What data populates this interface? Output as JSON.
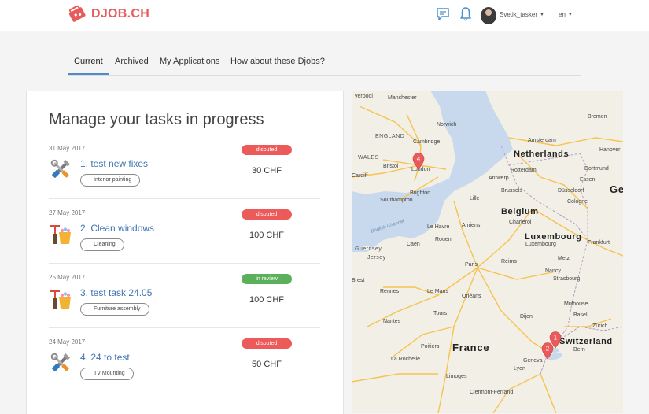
{
  "header": {
    "brand": "DJOB.CH",
    "username": "Svetik_tasker",
    "language": "en",
    "icons": {
      "logo": "tag-logo-icon",
      "messages": "chat-icon",
      "notifications": "bell-icon",
      "dropdown": "caret-down-icon"
    },
    "colors": {
      "brand": "#e85b5b",
      "icon": "#4a90c9"
    }
  },
  "tabs": [
    {
      "label": "Current",
      "active": true
    },
    {
      "label": "Archived",
      "active": false
    },
    {
      "label": "My Applications",
      "active": false
    },
    {
      "label": "How about these Djobs?",
      "active": false
    }
  ],
  "panel": {
    "title": "Manage your tasks in progress",
    "tasks": [
      {
        "date": "31 May 2017",
        "title": "1. test new fixes",
        "category": "Interior painting",
        "status": "disputed",
        "price": "30 CHF",
        "icon": "tools-icon"
      },
      {
        "date": "27 May 2017",
        "title": "2. Clean windows",
        "category": "Cleaning",
        "status": "disputed",
        "price": "100 CHF",
        "icon": "cleaning-icon"
      },
      {
        "date": "25 May 2017",
        "title": "3. test task 24.05",
        "category": "Furniture assembly",
        "status": "in review",
        "price": "100 CHF",
        "icon": "cleaning-icon"
      },
      {
        "date": "24 May 2017",
        "title": "4. 24 to test",
        "category": "TV Mounting",
        "status": "disputed",
        "price": "50 CHF",
        "icon": "tools-icon"
      }
    ],
    "status_colors": {
      "disputed": "#ec5a5a",
      "in review": "#5bb15b"
    }
  },
  "map": {
    "countries": [
      "Netherlands",
      "Belgium",
      "Luxembourg",
      "France",
      "Switzerland",
      "Ge"
    ],
    "regions": [
      "ENGLAND",
      "WALES",
      "Guernsey",
      "Jersey"
    ],
    "sea": "English Channel",
    "cities": [
      "verpool",
      "Manchester",
      "Cambridge",
      "Bristol",
      "London",
      "Brighton",
      "Southampton",
      "Cardiff",
      "Norwich",
      "Amsterdam",
      "Rotterdam",
      "Antwerp",
      "Brussels",
      "Lille",
      "Charleroi",
      "Essen",
      "Cologne",
      "Frankfurt",
      "Bremen",
      "Hanover",
      "Düsseldorf",
      "Dortmund",
      "Paris",
      "Reims",
      "Rouen",
      "Caen",
      "Le Havre",
      "Amiens",
      "Metz",
      "Strasbourg",
      "Nancy",
      "Rennes",
      "Brest",
      "Nantes",
      "Le Mans",
      "Tours",
      "Orléans",
      "Dijon",
      "Poitiers",
      "La Rochelle",
      "Limoges",
      "Lyon",
      "Geneva",
      "Bern",
      "Zürich",
      "Basel",
      "Mulhouse",
      "Clermont-Ferrand",
      "Luxembourg"
    ],
    "markers": [
      "4",
      "1",
      "2"
    ],
    "colors": {
      "water": "#c8d9ee",
      "land": "#f2efe6",
      "road": "#f6c350"
    }
  }
}
